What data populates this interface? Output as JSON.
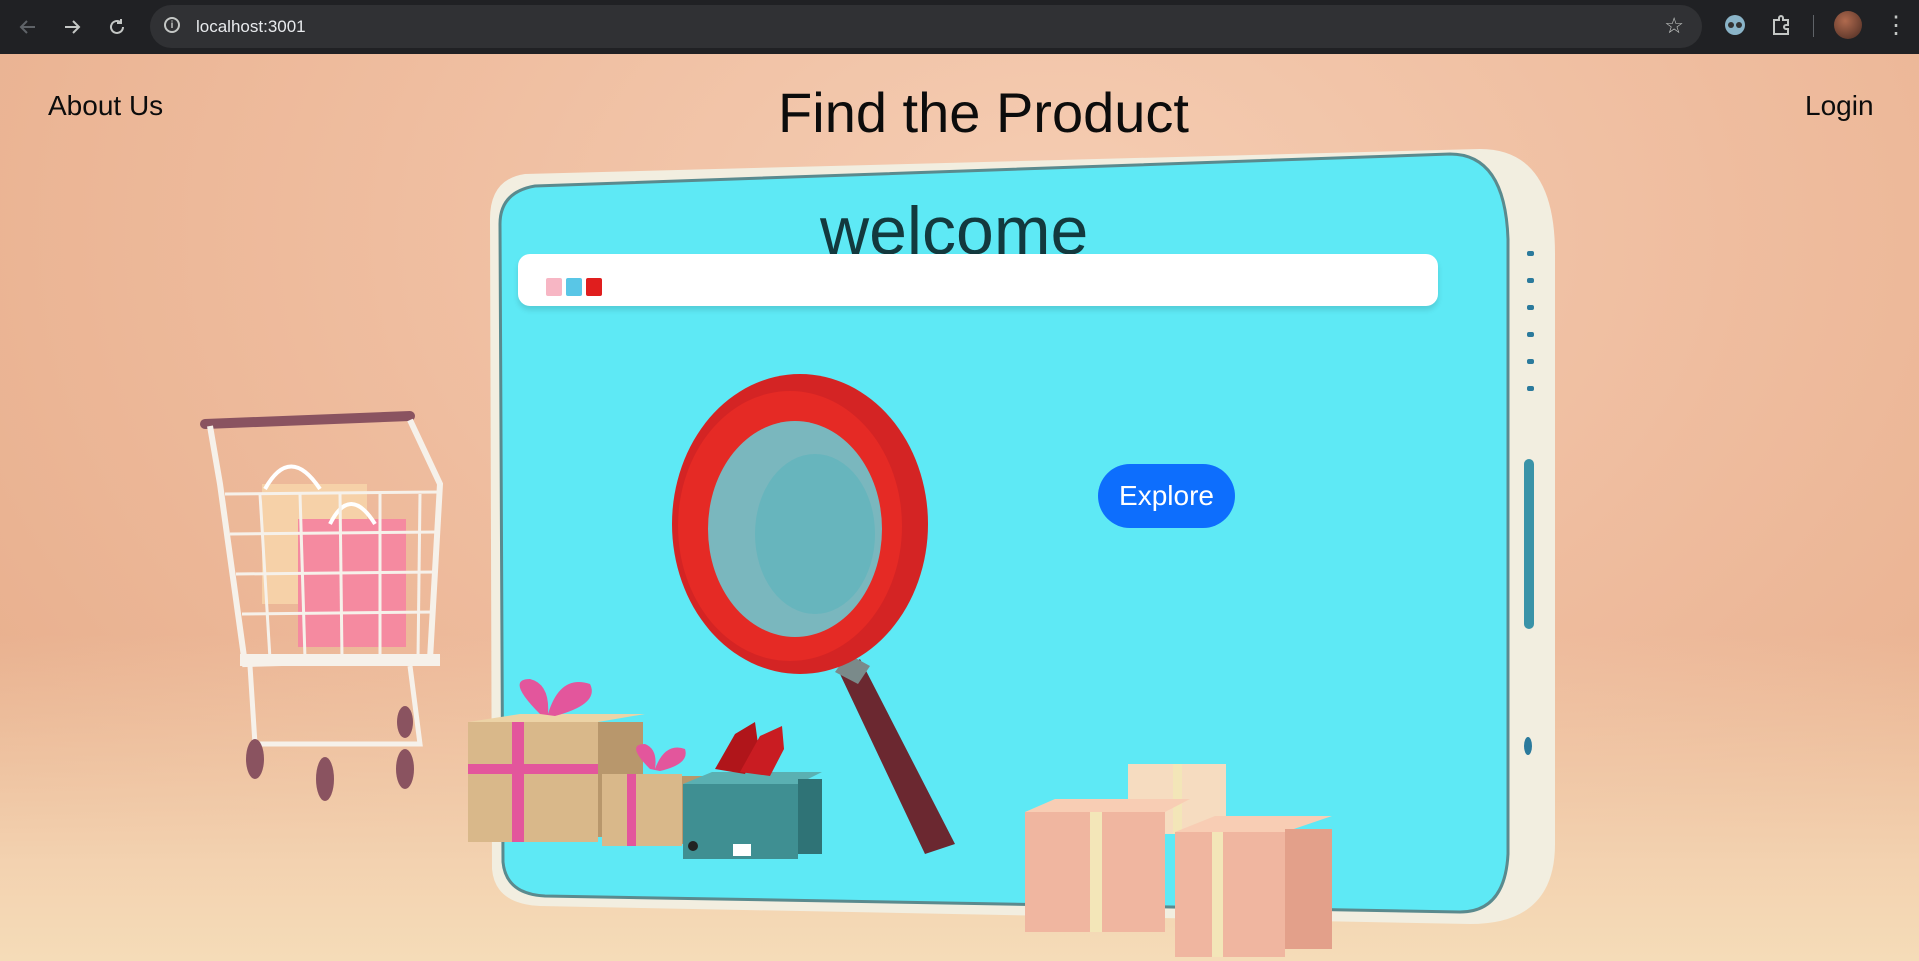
{
  "browser": {
    "url": "localhost:3001"
  },
  "header": {
    "about_label": "About Us",
    "title": "Find the Product",
    "login_label": "Login"
  },
  "hero": {
    "welcome": "welcome",
    "explore_label": "Explore",
    "search_dots": [
      "#f7b6c4",
      "#59c6e6",
      "#e01e1e"
    ]
  },
  "colors": {
    "screen": "#62eef6",
    "button": "#0d6efd"
  },
  "icons": [
    "back-icon",
    "forward-icon",
    "reload-icon",
    "info-icon",
    "star-icon",
    "extension-icon",
    "puzzle-icon",
    "avatar",
    "more-menu-icon"
  ]
}
